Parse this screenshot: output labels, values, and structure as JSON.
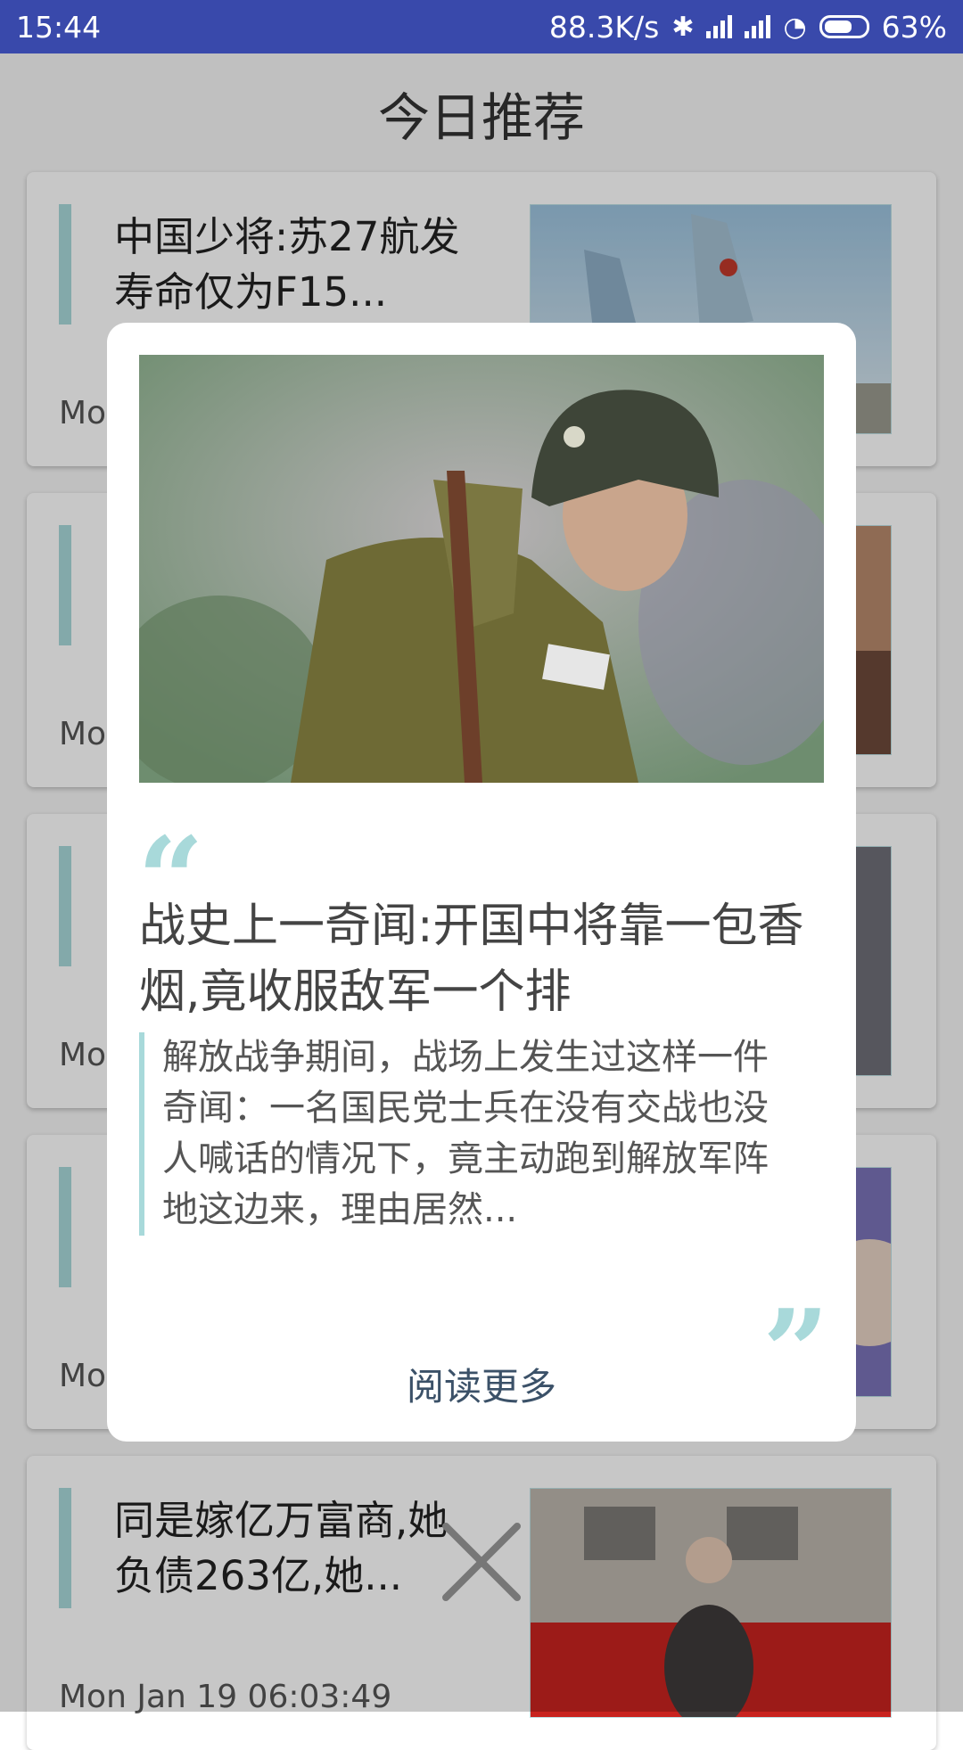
{
  "status_bar": {
    "time": "15:44",
    "net_speed": "88.3K/s",
    "battery": "63%",
    "icons": [
      "bluetooth-icon",
      "signal-icon",
      "signal-icon",
      "wifi-icon",
      "battery-icon"
    ]
  },
  "header": {
    "title": "今日推荐"
  },
  "cards": [
    {
      "title": "中国少将:苏27航发寿命仅为F15...",
      "date": "Mo"
    },
    {
      "title": "",
      "date": "Mo"
    },
    {
      "title": "",
      "date": "Mo"
    },
    {
      "title": "",
      "date": "Mo"
    },
    {
      "title": "同是嫁亿万富商,她负债263亿,她...",
      "date": "Mon Jan 19 06:03:49"
    }
  ],
  "dialog": {
    "title": "战史上一奇闻:开国中将靠一包香烟,竟收服敌军一个排",
    "excerpt": "解放战争期间，战场上发生过这样一件奇闻：一名国民党士兵在没有交战也没人喊话的情况下，竟主动跑到解放军阵地这边来，理由居然...",
    "read_more": "阅读更多"
  },
  "colors": {
    "status_bar": "#3949AB",
    "accent": "#A8D9DA",
    "link": "#3B5168"
  }
}
